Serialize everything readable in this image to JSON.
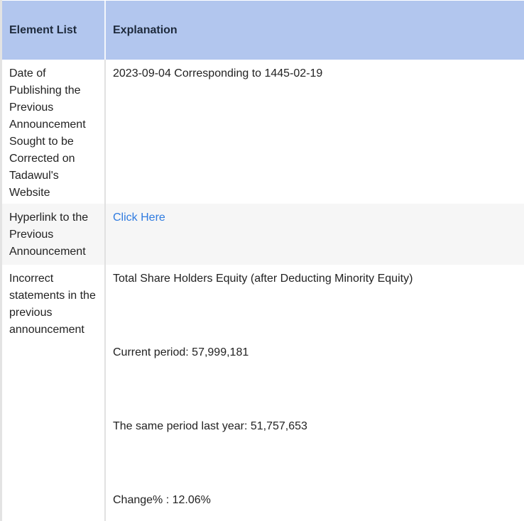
{
  "table": {
    "headers": {
      "element_list": "Element List",
      "explanation": "Explanation"
    },
    "rows": [
      {
        "element": "Date of Publishing the Previous Announcement Sought to be Corrected on Tadawul's Website",
        "explanation": "2023-09-04 Corresponding to 1445-02-19"
      },
      {
        "element": "Hyperlink to the Previous Announcement",
        "link_text": "Click Here"
      },
      {
        "element": "Incorrect statements in the previous announcement",
        "lines": [
          "Total Share Holders Equity (after Deducting Minority Equity)",
          "Current period: 57,999,181",
          "The same period last year: 51,757,653",
          "Change% : 12.06%"
        ]
      }
    ]
  },
  "colors": {
    "header_bg": "#b2c6ee",
    "link": "#2f7be0",
    "alt_row_bg": "#f6f6f6"
  }
}
